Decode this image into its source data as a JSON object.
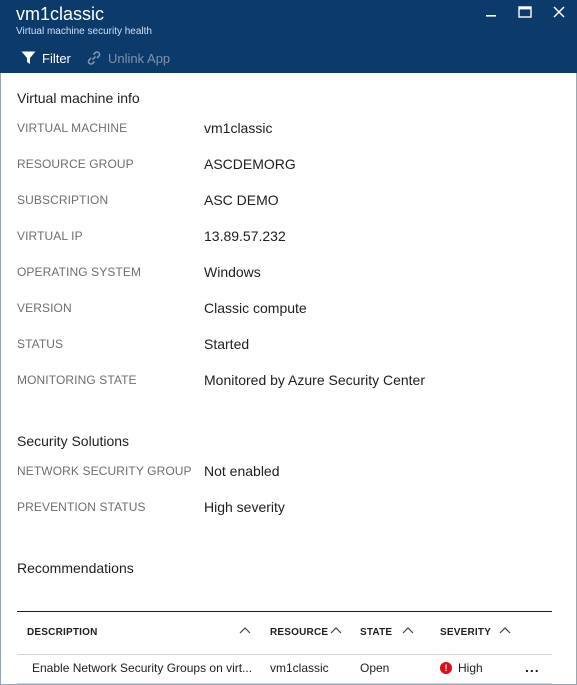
{
  "header": {
    "title": "vm1classic",
    "subtitle": "Virtual machine security health"
  },
  "toolbar": {
    "filter_label": "Filter",
    "unlink_label": "Unlink App"
  },
  "vm_info": {
    "title": "Virtual machine info",
    "rows": [
      {
        "label": "VIRTUAL MACHINE",
        "value": "vm1classic"
      },
      {
        "label": "RESOURCE GROUP",
        "value": "ASCDEMORG"
      },
      {
        "label": "SUBSCRIPTION",
        "value": "ASC DEMO"
      },
      {
        "label": "VIRTUAL IP",
        "value": "13.89.57.232"
      },
      {
        "label": "OPERATING SYSTEM",
        "value": "Windows"
      },
      {
        "label": "VERSION",
        "value": "Classic compute"
      },
      {
        "label": "STATUS",
        "value": "Started"
      },
      {
        "label": "MONITORING STATE",
        "value": "Monitored by Azure Security Center"
      }
    ]
  },
  "security_solutions": {
    "title": "Security Solutions",
    "rows": [
      {
        "label": "NETWORK SECURITY GROUP",
        "value": "Not enabled"
      },
      {
        "label": "PREVENTION STATUS",
        "value": "High severity"
      }
    ]
  },
  "recommendations": {
    "title": "Recommendations",
    "columns": [
      "DESCRIPTION",
      "RESOURCE",
      "STATE",
      "SEVERITY"
    ],
    "rows": [
      {
        "description": "Enable Network Security Groups on virt...",
        "resource": "vm1classic",
        "state": "Open",
        "severity": "High",
        "severity_icon": "!"
      }
    ],
    "more_label": "..."
  },
  "colors": {
    "header_bg": "#0b3a6b",
    "severity_high": "#e00b1c"
  }
}
